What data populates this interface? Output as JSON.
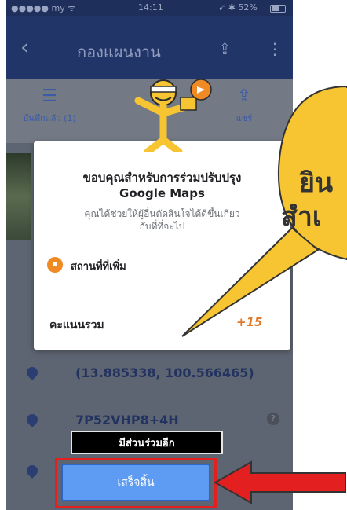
{
  "status_bar": {
    "carrier": "●●●●● my ᯤ",
    "time": "14:11",
    "right": "➹ ✱ 52%"
  },
  "app_bar": {
    "title": "กองแผนงาน"
  },
  "actions": {
    "saved_label": "บันทึกแล้ว (1)",
    "share_label": "แชร์"
  },
  "rows": {
    "coordinates": "(13.885338, 100.566465)",
    "plus_code": "7P52VHP8+4H",
    "help_glyph": "?"
  },
  "dialog": {
    "title_line1": "ขอบคุณสำหรับการร่วมปรับปรุง",
    "title_line2": "Google Maps",
    "subtitle_line1": "คุณได้ช่วยให้ผู้อื่นตัดสินใจได้ดีขึ้นเกี่ยว",
    "subtitle_line2": "กับที่ที่จะไป",
    "contribution_label": "สถานที่ที่เพิ่ม",
    "total_label": "คะแนนรวม",
    "total_points": "+15"
  },
  "callout": {
    "line1": "ยิน",
    "line2": "สำเ"
  },
  "buttons": {
    "contribute_more": "มีส่วนร่วมอีก",
    "done": "เสร็จสิ้น"
  },
  "colors": {
    "app_bar": "#213568",
    "overlay": "#5e6572",
    "accent_orange": "#e0792a",
    "done_button": "#5d9cf2",
    "highlight_red": "#e41f1f",
    "callout_yellow": "#f7c531"
  },
  "icons": {
    "back": "chevron-left-icon",
    "share": "share-icon",
    "more": "more-vertical-icon",
    "saved": "saved-list-icon",
    "pin": "location-pin-icon",
    "help": "help-icon"
  }
}
